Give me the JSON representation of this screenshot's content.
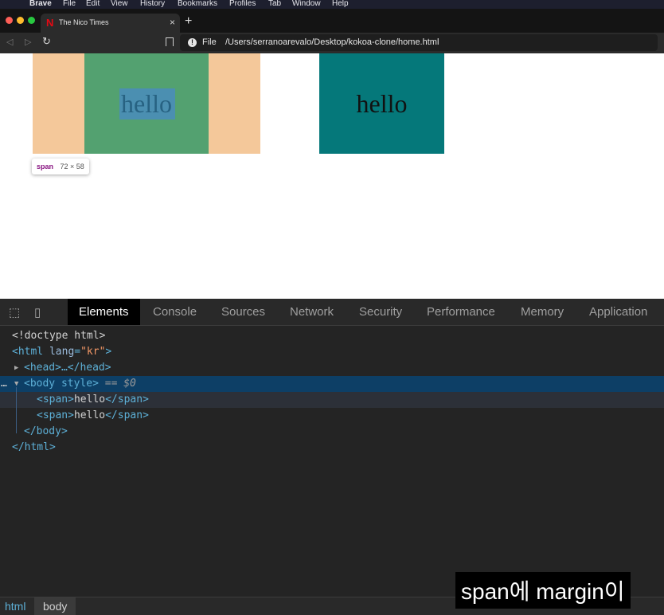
{
  "menubar": {
    "app": "Brave",
    "items": [
      "File",
      "Edit",
      "View",
      "History",
      "Bookmarks",
      "Profiles",
      "Tab",
      "Window",
      "Help"
    ]
  },
  "tab": {
    "title": "The Nico Times",
    "favicon": "N",
    "close": "×"
  },
  "newtab": "+",
  "address": {
    "scheme": "File",
    "url": "/Users/serranoarevalo/Desktop/kokoa-clone/home.html"
  },
  "page": {
    "span1_text": "hello",
    "span2_text": "hello",
    "tooltip": {
      "tag": "span",
      "size": "72 × 58"
    }
  },
  "devtools": {
    "tabs": [
      "Elements",
      "Console",
      "Sources",
      "Network",
      "Security",
      "Performance",
      "Memory",
      "Application"
    ],
    "active_tab": "Elements",
    "code": {
      "doctype": "<!doctype html>",
      "html_open": "<html",
      "lang_attr": "lang",
      "lang_value": "\"kr\"",
      "head": "<head>…</head>",
      "body_open": "<body style>",
      "body_eq": "== $0",
      "span_open": "<span>",
      "span_text": "hello",
      "span_close": "</span>",
      "body_close": "</body>",
      "html_close": "</html>"
    },
    "breadcrumbs": [
      "html",
      "body"
    ]
  },
  "subtitle": "span에 margin이",
  "colors": {
    "peach": "#f4c89a",
    "green": "#53a170",
    "teal": "#05787a",
    "selection": "#0d3f66",
    "active_tab": "#000000"
  }
}
